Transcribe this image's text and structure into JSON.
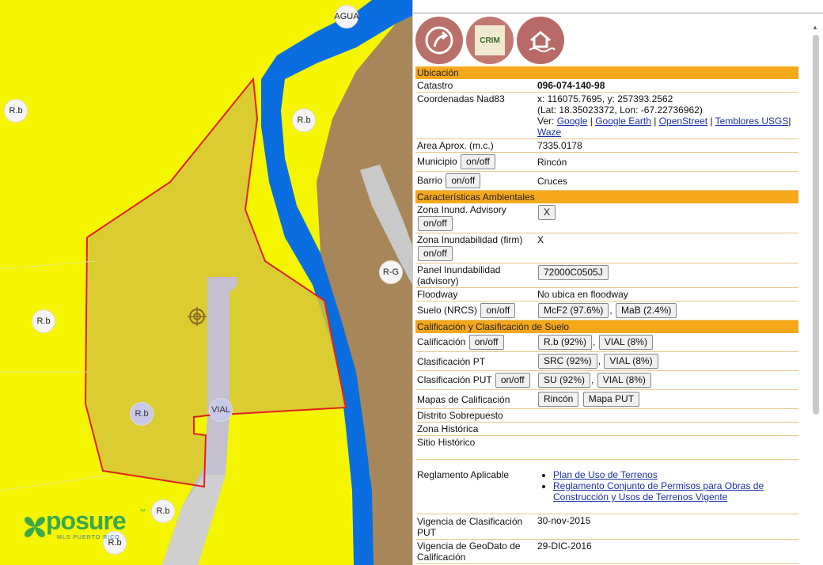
{
  "map": {
    "labels": {
      "agua": "AGUA",
      "rb1": "R.b",
      "rb2": "R.b",
      "rb3": "R.b",
      "rb4": "R.b",
      "rb5": "R.b",
      "rb6": "R.b",
      "rg": "R-G",
      "vial": "VIAL"
    },
    "logo": {
      "text": "posure",
      "tagline": "MLS PUERTO RICO",
      "tm": "™"
    },
    "colors": {
      "zone": "#f5f500",
      "river": "#0a6ee0",
      "slope": "#a7875a",
      "parcel": "#d8c23a",
      "road": "#c8c8c8",
      "boundary": "#e02020"
    }
  },
  "panel": {
    "icons": [
      "share-icon",
      "crim-logo-icon",
      "flood-house-icon"
    ],
    "crim_letters": "CRIM",
    "sections": {
      "ubicacion": "Ubicación",
      "ambientales": "Características Ambientales",
      "calificacion": "Calificación y Clasificación de Suelo"
    },
    "rows": {
      "catastro": {
        "label": "Catastro",
        "value": "096-074-140-98"
      },
      "coords": {
        "label": "Coordenadas Nad83",
        "line1": "x: 116075.7695, y: 257393.2562",
        "line2": "(Lat: 18.35023372, Lon: -67.22736962)",
        "ver": "Ver:",
        "links": [
          "Google",
          "Google Earth",
          "OpenStreet",
          "Temblores USGS",
          "Waze"
        ]
      },
      "area": {
        "label": "Area Aprox. (m.c.)",
        "value": "7335.0178"
      },
      "municipio": {
        "label": "Municipio",
        "button": "on/off",
        "value": "Rincón"
      },
      "barrio": {
        "label": "Barrio",
        "button": "on/off",
        "value": "Cruces"
      },
      "zona_inund_adv": {
        "label": "Zona Inund. Advisory",
        "button": "on/off",
        "value_button": "X"
      },
      "zona_inund_firm": {
        "label": "Zona Inundabilidad (firm)",
        "button": "on/off",
        "value": "X"
      },
      "panel_inund": {
        "label": "Panel Inundabilidad (advisory)",
        "value_button": "72000C0505J"
      },
      "floodway": {
        "label": "Floodway",
        "value": "No ubica en floodway"
      },
      "suelo": {
        "label": "Suelo (NRCS)",
        "button": "on/off",
        "values": [
          "McF2 (97.6%)",
          "MaB (2.4%)"
        ]
      },
      "calif": {
        "label": "Calificación",
        "button": "on/off",
        "values": [
          "R.b (92%)",
          "VIAL (8%)"
        ]
      },
      "clas_pt": {
        "label": "Clasificación PT",
        "values": [
          "SRC (92%)",
          "VIAL (8%)"
        ]
      },
      "clas_put": {
        "label": "Clasificación PUT",
        "button": "on/off",
        "values": [
          "SU (92%)",
          "VIAL (8%)"
        ]
      },
      "mapas": {
        "label": "Mapas de Calificación",
        "values": [
          "Rincón",
          "Mapa PUT"
        ]
      },
      "distrito": {
        "label": "Distrito Sobrepuesto"
      },
      "zona_hist": {
        "label": "Zona Histórica"
      },
      "sitio_hist": {
        "label": "Sitio Histórico"
      },
      "reglamento": {
        "label": "Reglamento Aplicable",
        "links": [
          "Plan de Uso de Terrenos",
          "Reglamento Conjunto de Permisos para Obras de Construcción y Usos de Terrenos Vigente"
        ]
      },
      "vigencia_put": {
        "label": "Vigencia de Clasificación PUT",
        "value": "30-nov-2015"
      },
      "vigencia_geo": {
        "label": "Vigencia de GeoDato de Calificación",
        "value": "29-DIC-2016"
      }
    }
  }
}
